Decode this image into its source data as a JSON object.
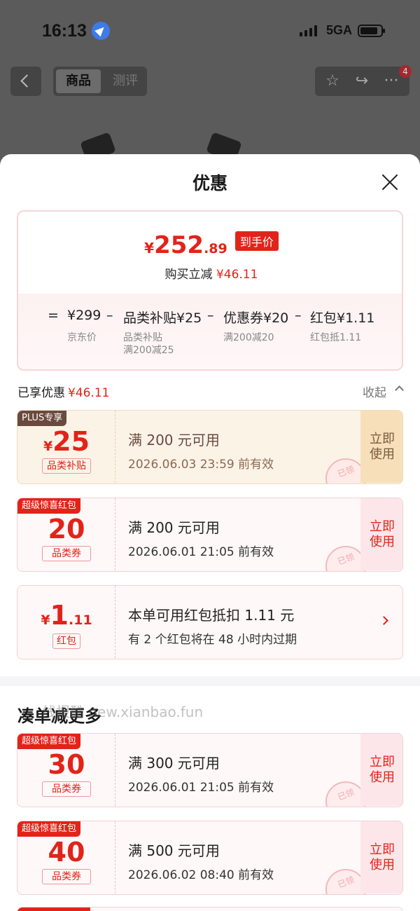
{
  "status_bar": {
    "time": "16:13",
    "network": "5GA"
  },
  "nav": {
    "tab_active": "商品",
    "tab_inactive": "测评",
    "badge": "4"
  },
  "sheet": {
    "title": "优惠",
    "summary": {
      "yen": "¥",
      "price_int": "252",
      "price_dec": ".89",
      "price_badge": "到手价",
      "instant_label": "购买立减",
      "instant_amount": "¥46.11",
      "breakdown": [
        {
          "op": "=",
          "main": "¥299",
          "sub": [
            "京东价"
          ]
        },
        {
          "op": "–",
          "main": "品类补贴¥25",
          "sub": [
            "品类补贴",
            "满200减25"
          ]
        },
        {
          "op": "–",
          "main": "优惠券¥20",
          "sub": [
            "满200减20"
          ]
        },
        {
          "op": "–",
          "main": "红包¥1.11",
          "sub": [
            "红包抵1.11"
          ]
        }
      ]
    },
    "enjoyed_label": "已享优惠",
    "enjoyed_amount": "¥46.11",
    "collapse_label": "收起",
    "coupons": [
      {
        "tag": "PLUS专享",
        "yen": "¥",
        "amount": "25",
        "type": "品类补贴",
        "cond": "满 200 元可用",
        "valid": "2026.06.03 23:59 前有效",
        "action": "立即使用",
        "stamp": "已领"
      },
      {
        "tag": "超级惊喜红包",
        "amount": "20",
        "type": "品类券",
        "cond": "满 200 元可用",
        "valid": "2026.06.01 21:05 前有效",
        "action": "立即使用",
        "stamp": "已领"
      },
      {
        "yen": "¥",
        "amount": "1",
        "amount_dec": ".11",
        "type": "红包",
        "cond": "本单可用红包抵扣 1.11 元",
        "valid": "有 2 个红包将在 48 小时内过期"
      }
    ],
    "more_title": "凑单减更多",
    "watermark": "线报酷 new.xianbao.fun",
    "more_coupons": [
      {
        "tag": "超级惊喜红包",
        "amount": "30",
        "type": "品类券",
        "cond": "满 300 元可用",
        "valid": "2026.06.01 21:05 前有效",
        "action": "立即使用",
        "stamp": "已领"
      },
      {
        "tag": "超级惊喜红包",
        "amount": "40",
        "type": "品类券",
        "cond": "满 500 元可用",
        "valid": "2026.06.02 08:40 前有效",
        "action": "立即使用",
        "stamp": "已领"
      }
    ]
  },
  "colors": {
    "accent": "#e2231a",
    "gold": "#6b4a3e"
  }
}
